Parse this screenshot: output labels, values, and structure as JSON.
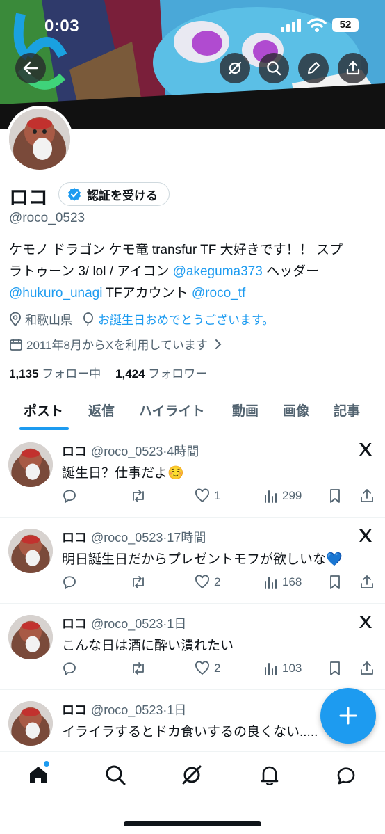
{
  "status_bar": {
    "time": "0:03",
    "battery": "52"
  },
  "profile": {
    "name": "ロコ",
    "verify_label": "認証を受ける",
    "handle": "@roco_0523",
    "bio_line1": "ケモノ ドラゴン ケモ竜 transfur TF 大好きです！！ スプ",
    "bio_line2_text": "ラトゥーン 3/ lol / アイコン ",
    "bio_link1": "@akeguma373",
    "bio_line2_tail": " ヘッダー",
    "bio_link2": "@hukuro_unagi",
    "bio_line3_mid": " TFアカウント ",
    "bio_link3": "@roco_tf",
    "location": "和歌山県",
    "birthday": "お誕生日おめでとうございます。",
    "joined": "2011年8月からXを利用しています",
    "following_count": "1,135",
    "following_label": "フォロー中",
    "followers_count": "1,424",
    "followers_label": "フォロワー"
  },
  "tabs": [
    "ポスト",
    "返信",
    "ハイライト",
    "動画",
    "画像",
    "記事"
  ],
  "posts": [
    {
      "name": "ロコ",
      "handle": "@roco_0523",
      "time": "4時間",
      "text": "誕生日？仕事だよ☺️",
      "likes": "1",
      "views": "299"
    },
    {
      "name": "ロコ",
      "handle": "@roco_0523",
      "time": "17時間",
      "text": "明日誕生日だからプレゼントモフが欲しいな💙",
      "likes": "2",
      "views": "168"
    },
    {
      "name": "ロコ",
      "handle": "@roco_0523",
      "time": "1日",
      "text": "こんな日は酒に酔い潰れたい",
      "likes": "2",
      "views": "103"
    },
    {
      "name": "ロコ",
      "handle": "@roco_0523",
      "time": "1日",
      "text": "イライラするとドカ食いするの良くない.....",
      "likes": "",
      "views": ""
    }
  ],
  "icons": {
    "back": "back-arrow-icon",
    "grok": "grok-icon",
    "search": "search-icon",
    "edit": "edit-icon",
    "share": "share-icon",
    "verified": "verified-badge-icon",
    "compose": "plus-icon"
  },
  "colors": {
    "accent": "#1d9bf0",
    "text": "#0f1419",
    "secondary": "#536471"
  }
}
